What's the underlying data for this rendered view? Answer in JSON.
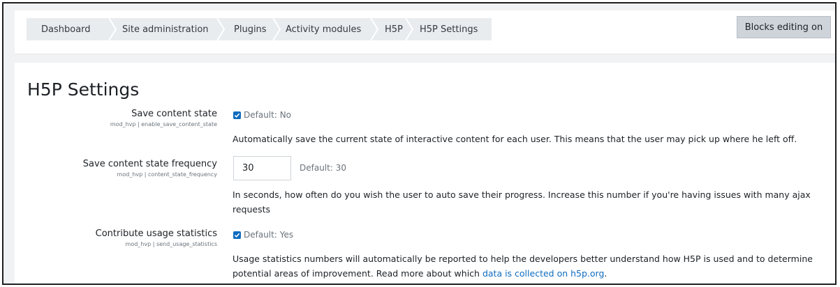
{
  "breadcrumb": [
    {
      "label": "Dashboard"
    },
    {
      "label": "Site administration"
    },
    {
      "label": "Plugins"
    },
    {
      "label": "Activity modules"
    },
    {
      "label": "H5P"
    },
    {
      "label": "H5P Settings"
    }
  ],
  "header": {
    "editing_button": "Blocks editing on"
  },
  "page": {
    "title": "H5P Settings"
  },
  "settings": [
    {
      "label": "Save content state",
      "key": "mod_hvp | enable_save_content_state",
      "checked": true,
      "default": "Default: No",
      "description": "Automatically save the current state of interactive content for each user. This means that the user may pick up where he left off."
    },
    {
      "label": "Save content state frequency",
      "key": "mod_hvp | content_state_frequency",
      "value": "30",
      "default": "Default: 30",
      "description": "In seconds, how often do you wish the user to auto save their progress. Increase this number if you're having issues with many ajax requests"
    },
    {
      "label": "Contribute usage statistics",
      "key": "mod_hvp | send_usage_statistics",
      "checked": true,
      "default": "Default: Yes",
      "description": "Usage statistics numbers will automatically be reported to help the developers better understand how H5P is used and to determine potential areas of improvement. Read more about which",
      "link_text": "data is collected on h5p.org",
      "trailing": "."
    }
  ],
  "colors": {
    "accent": "#0f6cbf",
    "breadcrumb_bg": "#e9ecef",
    "button_bg": "#ced4da",
    "page_bg": "#f1f2f4"
  },
  "icons": {
    "checkbox": "check-icon",
    "separator": "chevron-right-icon"
  }
}
